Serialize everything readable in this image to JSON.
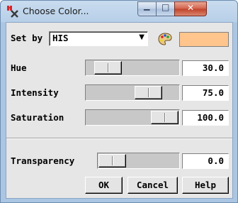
{
  "window": {
    "title": "Choose Color...",
    "min_glyph": "▁",
    "max_glyph": "□",
    "close_glyph": "✕"
  },
  "set_by": {
    "label": "Set by",
    "value": "HIS",
    "dropdown_glyph": "▼"
  },
  "swatch_color": "#ffc58c",
  "sliders": [
    {
      "label": "Hue",
      "value": "30.0",
      "position_fraction": 0.12
    },
    {
      "label": "Intensity",
      "value": "75.0",
      "position_fraction": 0.75
    },
    {
      "label": "Saturation",
      "value": "100.0",
      "position_fraction": 1.0
    },
    {
      "label": "Transparency",
      "value": "0.0",
      "position_fraction": 0.0
    }
  ],
  "buttons": {
    "ok": "OK",
    "cancel": "Cancel",
    "help": "Help"
  }
}
